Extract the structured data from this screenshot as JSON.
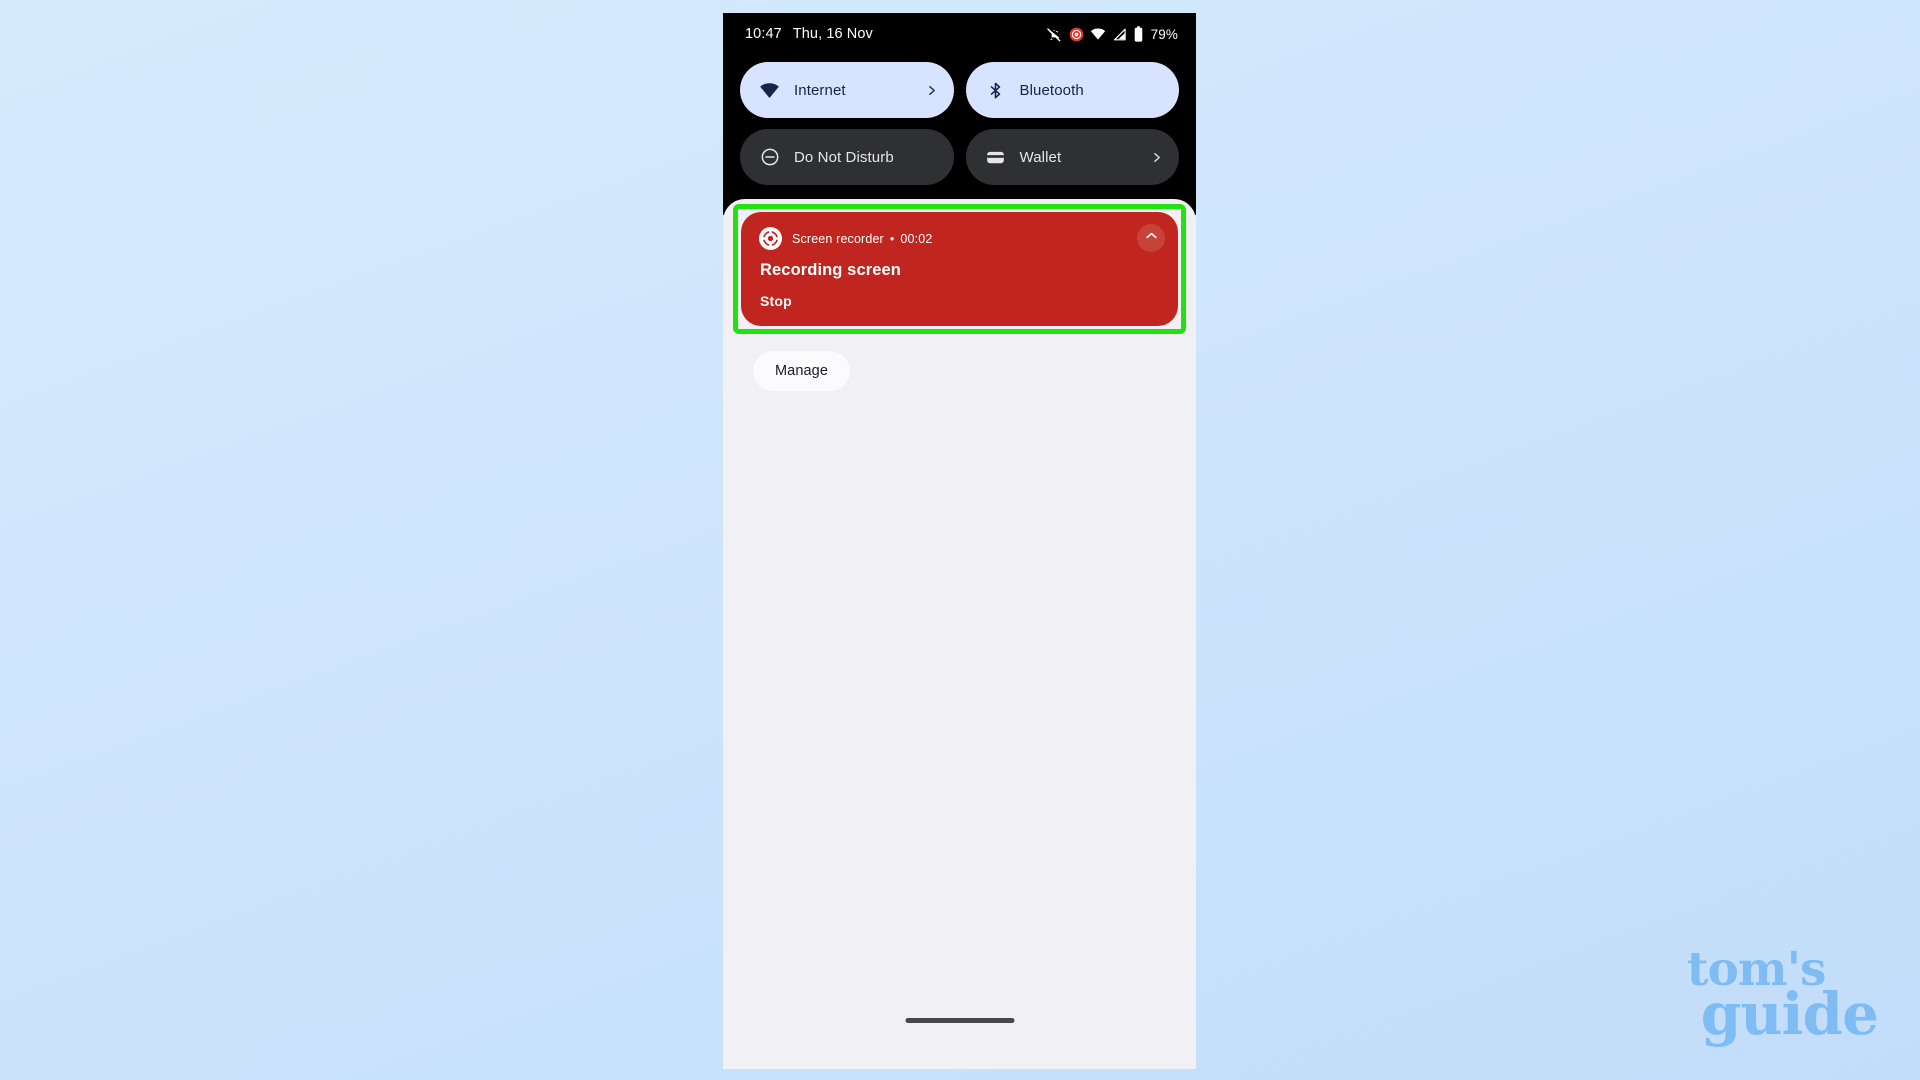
{
  "status_bar": {
    "time": "10:47",
    "date": "Thu, 16 Nov",
    "battery_percent": "79%",
    "icons": [
      "vibrate-off-icon",
      "screen-recording-indicator-icon",
      "wifi-icon",
      "cellular-signal-icon",
      "battery-icon"
    ]
  },
  "quick_settings": {
    "tiles": [
      {
        "label": "Internet",
        "icon": "wifi-icon",
        "state": "on",
        "chevron": true
      },
      {
        "label": "Bluetooth",
        "icon": "bluetooth-icon",
        "state": "on",
        "chevron": false
      },
      {
        "label": "Do Not Disturb",
        "icon": "do-not-disturb-icon",
        "state": "off",
        "chevron": false
      },
      {
        "label": "Wallet",
        "icon": "wallet-icon",
        "state": "off",
        "chevron": true
      }
    ]
  },
  "notification": {
    "app_name": "Screen recorder",
    "separator": "•",
    "duration": "00:02",
    "title": "Recording screen",
    "action_label": "Stop",
    "app_icon": "screen-recorder-icon",
    "collapse_icon": "chevron-up-icon",
    "background_color": "#c0261f"
  },
  "shade": {
    "manage_label": "Manage"
  },
  "annotation": {
    "highlight_color": "#22e211"
  },
  "watermark": {
    "line1": "tom's",
    "line2": "guide",
    "color": "#7fbcf3"
  }
}
